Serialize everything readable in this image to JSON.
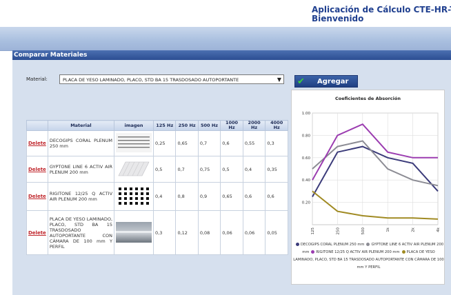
{
  "app": {
    "title_line1": "Aplicación de Cálculo CTE-HR-T",
    "title_line2": "Bienvenido"
  },
  "panel": {
    "header": "Comparar Materiales"
  },
  "form": {
    "material_label": "Material:",
    "selected_material": "PLACA DE YESO LAMINADO, PLACO, STD BA 15 TRASDOSADO AUTOPORTANTE",
    "add_button": "Agregar"
  },
  "table": {
    "headers": {
      "material": "Material",
      "imagen": "imagen",
      "f125": "125 Hz",
      "f250": "250 Hz",
      "f500": "500 Hz",
      "f1000": "1000 Hz",
      "f2000": "2000 Hz",
      "f4000": "4000 Hz"
    },
    "delete_label": "Delete",
    "rows": [
      {
        "name": "DECOGIPS CORAL PLENUM 250 mm",
        "v": [
          "0,25",
          "0,65",
          "0,7",
          "0,6",
          "0,55",
          "0,3"
        ]
      },
      {
        "name": "GYPTONE LINE 6 ACTIV AIR PLENUM 200 mm",
        "v": [
          "0,5",
          "0,7",
          "0,75",
          "0,5",
          "0,4",
          "0,35"
        ]
      },
      {
        "name": "RIGITONE 12/25 Q ACTIV AIR PLENUM 200 mm",
        "v": [
          "0,4",
          "0,8",
          "0,9",
          "0,65",
          "0,6",
          "0,6"
        ]
      },
      {
        "name": "PLACA DE YESO LAMINADO, PLACO, STD BA 15 TRASDOSADO AUTOPORTANTE CON CÁMARA DE 100 mm Y PERFIL",
        "v": [
          "0,3",
          "0,12",
          "0,08",
          "0,06",
          "0,06",
          "0,05"
        ]
      }
    ]
  },
  "chart_data": {
    "type": "line",
    "title": "Coeficientes de Absorción",
    "categories": [
      "125",
      "250",
      "500",
      "1k",
      "2k",
      "4k"
    ],
    "ylim": [
      0,
      1
    ],
    "yticks": [
      "0.20",
      "0.40",
      "0.60",
      "0.80",
      "1.00"
    ],
    "grid": true,
    "legend_position": "bottom",
    "series": [
      {
        "name": "DECOGIPS CORAL PLENUM 250 mm",
        "color": "#3b3b7a",
        "values": [
          0.25,
          0.65,
          0.7,
          0.6,
          0.55,
          0.3
        ]
      },
      {
        "name": "GYPTONE LINE 6 ACTIV AIR PLENUM 200 mm",
        "color": "#8c8c94",
        "values": [
          0.5,
          0.7,
          0.75,
          0.5,
          0.4,
          0.35
        ]
      },
      {
        "name": "RIGITONE 12/25 Q ACTIV AIR PLENUM 200 mm",
        "color": "#9b3cb0",
        "values": [
          0.4,
          0.8,
          0.9,
          0.65,
          0.6,
          0.6
        ]
      },
      {
        "name": "PLACA DE YESO LAMINADO, PLACO, STD BA 15 TRASDOSADO AUTOPORTANTE CON CÁMARA DE 100 mm Y PERFIL",
        "color": "#a08a22",
        "values": [
          0.3,
          0.12,
          0.08,
          0.06,
          0.06,
          0.05
        ]
      }
    ]
  }
}
